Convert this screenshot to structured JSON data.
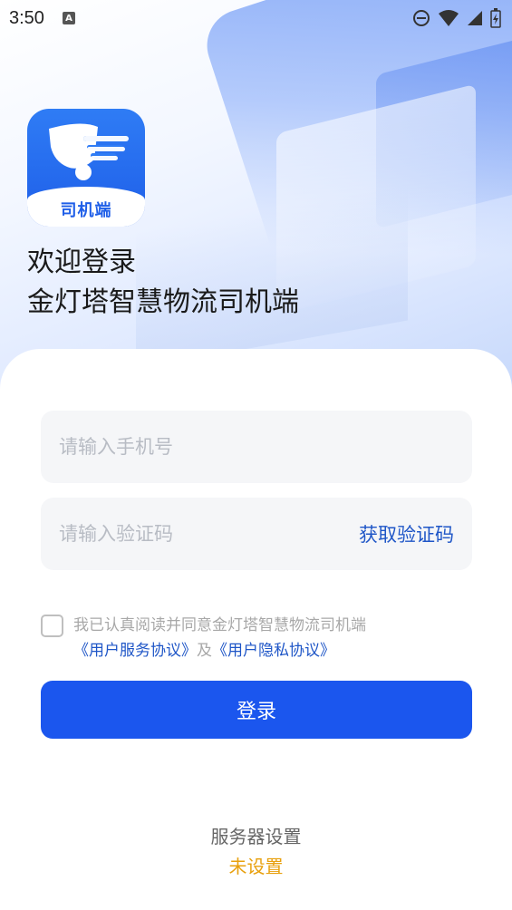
{
  "status_bar": {
    "time": "3:50",
    "notification_icon": "a-icon",
    "a_glyph": "A",
    "icons": [
      "do-not-disturb-icon",
      "wifi-icon",
      "signal-icon",
      "battery-icon"
    ]
  },
  "app": {
    "logo_label": "司机端",
    "welcome_line1": "欢迎登录",
    "welcome_line2": "金灯塔智慧物流司机端"
  },
  "form": {
    "phone_placeholder": "请输入手机号",
    "phone_value": "",
    "code_placeholder": "请输入验证码",
    "code_value": "",
    "get_code_label": "获取验证码"
  },
  "agreement": {
    "checked": false,
    "text_prefix": "我已认真阅读并同意金灯塔智慧物流司机端",
    "user_agreement": "《用户服务协议》",
    "conjunction": "及",
    "privacy_agreement": "《用户隐私协议》"
  },
  "login_label": "登录",
  "server": {
    "label": "服务器设置",
    "value": "未设置"
  },
  "colors": {
    "primary": "#1b56ee",
    "link": "#1f56c7",
    "warning": "#e8a00d",
    "input_bg": "#f5f6f8"
  }
}
